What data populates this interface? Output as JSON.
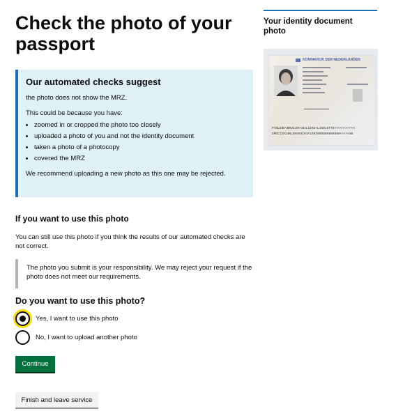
{
  "page": {
    "title": "Check the photo of your passport"
  },
  "panel": {
    "heading": "Our automated checks suggest",
    "finding": "the photo does not show the MRZ.",
    "reasons_intro": "This could be because you have:",
    "reasons": [
      "zoomed in or cropped the photo too closely",
      "uploaded a photo of you and not the identity document",
      "taken a photo of a photocopy",
      "covered the MRZ"
    ],
    "recommendation": "We recommend uploading a new photo as this one may be rejected."
  },
  "use_section": {
    "heading": "If you want to use this photo",
    "text": "You can still use this photo if you think the results of our automated checks are not correct.",
    "inset": "The photo you submit is your responsibility. We may reject your request if the photo does not meet our requirements."
  },
  "question": {
    "legend": "Do you want to use this photo?",
    "options": [
      {
        "label": "Yes, I want to use this photo",
        "selected": true
      },
      {
        "label": "No, I want to upload another photo",
        "selected": false
      }
    ]
  },
  "buttons": {
    "continue": "Continue",
    "finish": "Finish and leave service"
  },
  "sidebar": {
    "title": "Your identity document photo",
    "passport_header": "KONINKRIJK DER NEDERLANDEN",
    "mrz_line1": "P<NLDDE<BRUIJN<<WILLEKE<LISELOTTE<<<<<<<<<<<",
    "mrz_line2": "SPECI2014NLD6503101F2403096999999990<<<<<86"
  },
  "colors": {
    "panel_background": "#dff0f7",
    "panel_border": "#1d70b8",
    "continue_button": "#00703c",
    "focus": "#ffdd00"
  }
}
